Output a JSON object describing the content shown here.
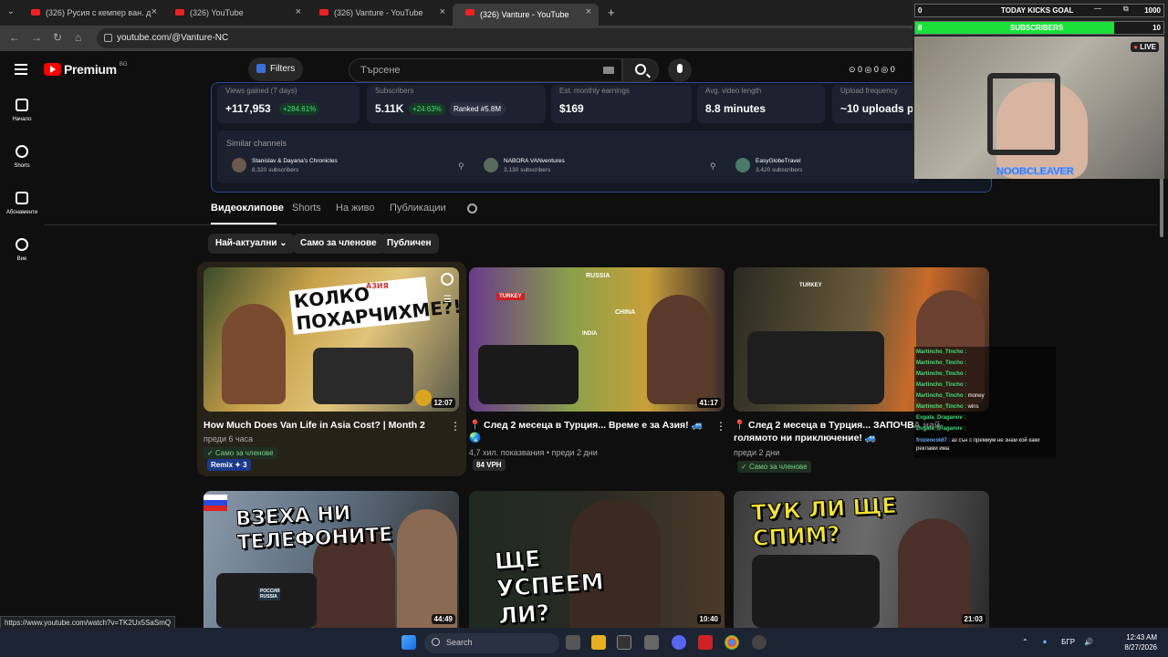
{
  "browser": {
    "tabs": [
      {
        "title": "(326) Русия с кемпер ван. д"
      },
      {
        "title": "(326) YouTube"
      },
      {
        "title": "(326) Vanture - YouTube"
      },
      {
        "title": "(326) Vanture - YouTube"
      }
    ],
    "new_tab": "+",
    "url": "youtube.com/@Vanture-NC"
  },
  "header": {
    "logo_text": "Premium",
    "country": "BG",
    "filters_label": "Filters",
    "search_placeholder": "Търсене",
    "counters": "⊙ 0 ◎ 0 ◎ 0"
  },
  "sidebar": {
    "items": [
      {
        "label": "Начало"
      },
      {
        "label": "Shorts"
      },
      {
        "label": "Абонаменти"
      },
      {
        "label": "Вие"
      }
    ]
  },
  "stats": {
    "cards": [
      {
        "label": "Views gained (7 days)",
        "value": "+117,953",
        "pct": "+284.61%"
      },
      {
        "label": "Subscribers",
        "value": "5.11K",
        "pct": "+24.63%",
        "rank": "Ranked #5.8M"
      },
      {
        "label": "Est. monthly earnings",
        "value": "$169"
      },
      {
        "label": "Avg. video length",
        "value": "8.8 minutes"
      },
      {
        "label": "Upload frequency",
        "value": "~10 uploads p"
      }
    ],
    "similar_title": "Similar channels",
    "similar": [
      {
        "name": "Stanislav & Dayana's Chronicles",
        "subs": "8,320 subscribers"
      },
      {
        "name": "NABORA VANventures",
        "subs": "3,130 subscribers"
      },
      {
        "name": "EasyGlobeTravel",
        "subs": "3,420 subscribers"
      }
    ]
  },
  "channel_tabs": [
    "Видеоклипове",
    "Shorts",
    "На живо",
    "Публикации"
  ],
  "chips": [
    "Най-актуални",
    "Само за членове",
    "Публичен"
  ],
  "videos": [
    {
      "title": "How Much Does Van Life in Asia Cost? | Month 2",
      "meta": "преди 6 часа",
      "badge": "Само за членове",
      "remix": "Remix ✦ 3",
      "duration": "12:07",
      "thumb_text": "КОЛКО ПОХАРЧИХМЕ?!",
      "thumb_small": "АЗИЯ"
    },
    {
      "title": "📍 След 2 месеца в Турция... Време е за Азия! 🚙🌏",
      "meta": "4,7 хил. показвания • преди 2 дни",
      "vph": "84 VPH",
      "duration": "41:17",
      "map_labels": [
        "RUSSIA",
        "TURKEY",
        "CHINA",
        "INDIA"
      ]
    },
    {
      "title": "📍 След 2 месеца в Турция... ЗАПОЧВА най-голямото ни приключение! 🚙",
      "meta": "преди 2 дни",
      "badge": "Само за членове",
      "duration": "",
      "map_labels": [
        "TURKEY"
      ]
    },
    {
      "title": "",
      "duration": "44:49",
      "thumb_text": "ВЗЕХА НИ ТЕЛЕФОНИТЕ",
      "sign": "РОССИЯ RUSSIA"
    },
    {
      "title": "",
      "duration": "10:40",
      "thumb_text": "ЩЕ УСПЕЕМ ЛИ?"
    },
    {
      "title": "",
      "duration": "21:03",
      "thumb_text": "ТУК ЛИ ЩЕ СПИМ?"
    }
  ],
  "overlay": {
    "goal_left": "0",
    "goal_title": "TODAY KICKS GOAL",
    "goal_right": "1000",
    "subs_left": "8",
    "subs_title": "SUBSCRIBERS",
    "subs_right": "10",
    "subs_progress": 0.8,
    "live": "LIVE",
    "streamer": "NOOBCLEAVER"
  },
  "chat": [
    {
      "user": "Martincho_Tincho",
      "msg": ""
    },
    {
      "user": "Martincho_Tincho",
      "msg": ""
    },
    {
      "user": "Martincho_Tincho",
      "msg": ""
    },
    {
      "user": "Martincho_Tincho",
      "msg": ""
    },
    {
      "user": "Martincho_Tincho",
      "msg": "money"
    },
    {
      "user": "Martincho_Tincho",
      "msg": "wins"
    },
    {
      "user": "Evgata_Draganov",
      "msg": ""
    },
    {
      "user": "Evgata_Draganov",
      "msg": ""
    },
    {
      "user": "frozencold7",
      "msg": "аз сън с премиум не знам кой каки реклами има"
    }
  ],
  "status_url": "https://www.youtube.com/watch?v=TK2Ux5SaSmQ",
  "taskbar": {
    "search": "Search",
    "lang": "БГР",
    "time": "12:43 AM",
    "date": "8/27/2026"
  }
}
